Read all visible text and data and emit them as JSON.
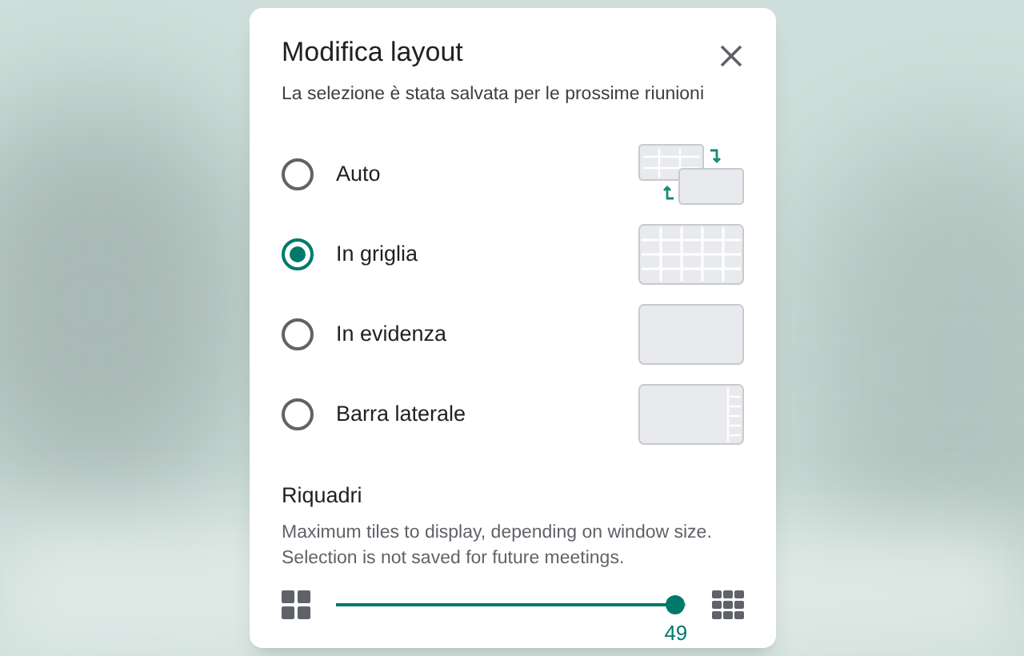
{
  "dialog": {
    "title": "Modifica layout",
    "subtitle": "La selezione è stata salvata per le prossime riunioni",
    "options": [
      {
        "label": "Auto",
        "kind": "auto",
        "selected": false
      },
      {
        "label": "In griglia",
        "kind": "grid",
        "selected": true
      },
      {
        "label": "In evidenza",
        "kind": "spotlight",
        "selected": false
      },
      {
        "label": "Barra laterale",
        "kind": "sidebar",
        "selected": false
      }
    ],
    "tiles": {
      "title": "Riquadri",
      "description": "Maximum tiles to display, depending on window size.\nSelection is not saved for future meetings.",
      "level": 0.97,
      "reading": "49"
    }
  }
}
